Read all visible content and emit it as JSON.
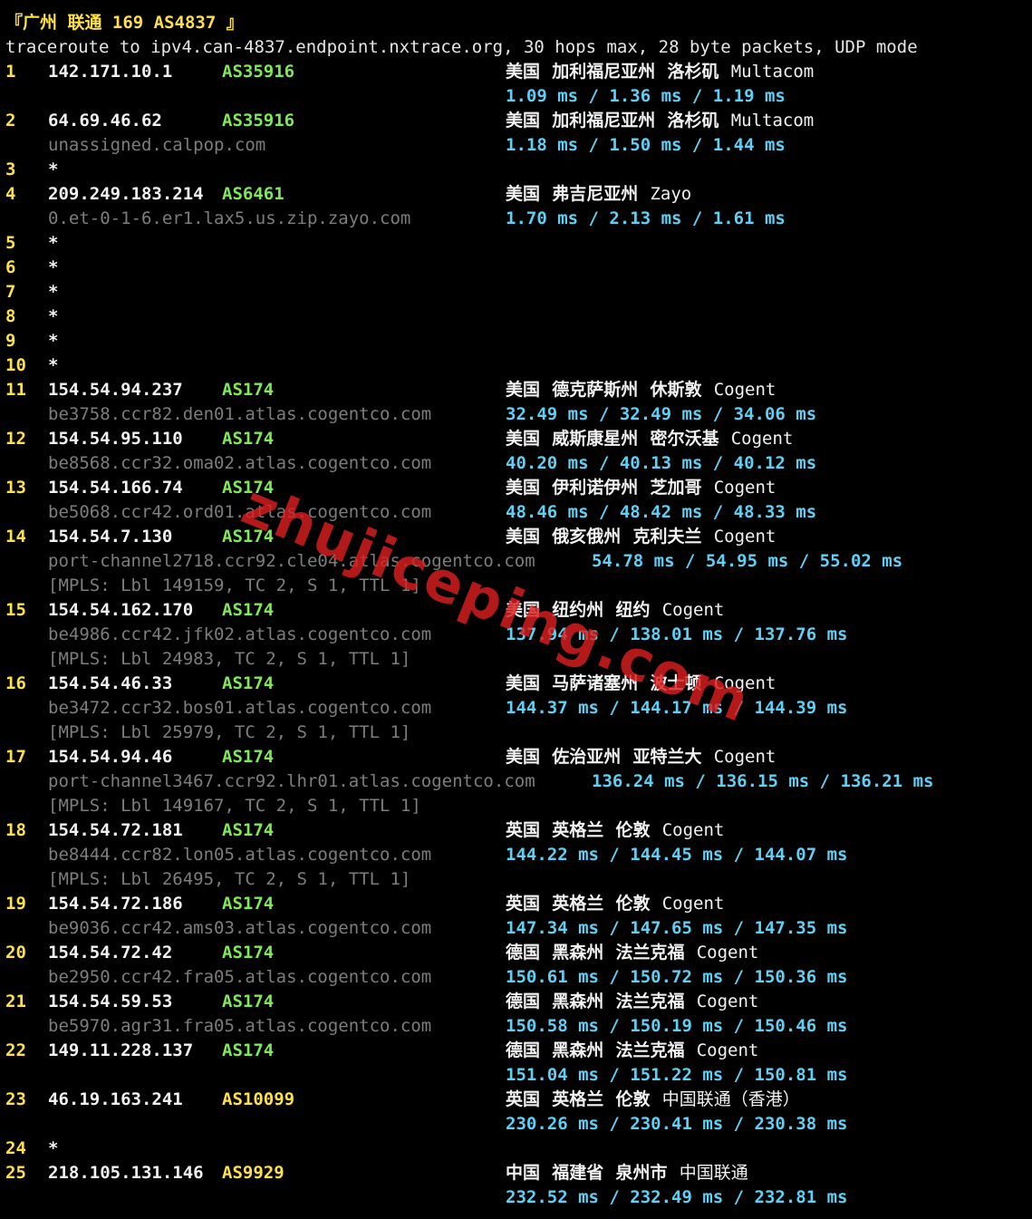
{
  "header": "『广州 联通 169 AS4837 』",
  "command": "traceroute to ipv4.can-4837.endpoint.nxtrace.org, 30 hops max, 28 byte packets, UDP mode",
  "watermark": "zhujiceping.com",
  "colors": {
    "background": "#000000",
    "hop_number": "#ffe04a",
    "asn_green": "#7fe858",
    "asn_yellow": "#ffe04a",
    "hostname": "#7d7d7d",
    "rtt": "#5fd0f5",
    "watermark": "#dc1e1e"
  },
  "hops": [
    {
      "hop": "1",
      "ip": "142.171.10.1",
      "asn": "AS35916",
      "asn_color": "green",
      "geo": "美国  加利福尼亚州  洛杉矶",
      "org": "Multacom",
      "host": "",
      "rtt": "1.09 ms / 1.36 ms / 1.19 ms",
      "mpls": ""
    },
    {
      "hop": "2",
      "ip": "64.69.46.62",
      "asn": "AS35916",
      "asn_color": "green",
      "geo": "美国  加利福尼亚州  洛杉矶",
      "org": "Multacom",
      "host": "unassigned.calpop.com",
      "rtt": "1.18 ms / 1.50 ms / 1.44 ms",
      "mpls": ""
    },
    {
      "hop": "3",
      "star": "*"
    },
    {
      "hop": "4",
      "ip": "209.249.183.214",
      "asn": "AS6461",
      "asn_color": "green",
      "geo": "美国  弗吉尼亚州",
      "org": "Zayo",
      "host": "0.et-0-1-6.er1.lax5.us.zip.zayo.com",
      "rtt": "1.70 ms / 2.13 ms / 1.61 ms",
      "mpls": ""
    },
    {
      "hop": "5",
      "star": "*"
    },
    {
      "hop": "6",
      "star": "*"
    },
    {
      "hop": "7",
      "star": "*"
    },
    {
      "hop": "8",
      "star": "*"
    },
    {
      "hop": "9",
      "star": "*"
    },
    {
      "hop": "10",
      "star": "*"
    },
    {
      "hop": "11",
      "ip": "154.54.94.237",
      "asn": "AS174",
      "asn_color": "green",
      "geo": "美国  德克萨斯州  休斯敦",
      "org": "Cogent",
      "host": "be3758.ccr82.den01.atlas.cogentco.com",
      "rtt": "32.49 ms / 32.49 ms / 34.06 ms",
      "mpls": ""
    },
    {
      "hop": "12",
      "ip": "154.54.95.110",
      "asn": "AS174",
      "asn_color": "green",
      "geo": "美国  威斯康星州  密尔沃基",
      "org": "Cogent",
      "host": "be8568.ccr32.oma02.atlas.cogentco.com",
      "rtt": "40.20 ms / 40.13 ms / 40.12 ms",
      "mpls": ""
    },
    {
      "hop": "13",
      "ip": "154.54.166.74",
      "asn": "AS174",
      "asn_color": "green",
      "geo": "美国  伊利诺伊州  芝加哥",
      "org": "Cogent",
      "host": "be5068.ccr42.ord01.atlas.cogentco.com",
      "rtt": "48.46 ms / 48.42 ms / 48.33 ms",
      "mpls": ""
    },
    {
      "hop": "14",
      "ip": "154.54.7.130",
      "asn": "AS174",
      "asn_color": "green",
      "geo": "美国  俄亥俄州  克利夫兰",
      "org": "Cogent",
      "host": "port-channel2718.ccr92.cle04.atlas.cogentco.com",
      "rtt": "54.78 ms / 54.95 ms / 55.02 ms",
      "mpls": "[MPLS: Lbl 149159, TC 2, S 1, TTL 1]"
    },
    {
      "hop": "15",
      "ip": "154.54.162.170",
      "asn": "AS174",
      "asn_color": "green",
      "geo": "美国  纽约州  纽约",
      "org": "Cogent",
      "host": "be4986.ccr42.jfk02.atlas.cogentco.com",
      "rtt": "137.94 ms / 138.01 ms / 137.76 ms",
      "mpls": "[MPLS: Lbl 24983, TC 2, S 1, TTL 1]"
    },
    {
      "hop": "16",
      "ip": "154.54.46.33",
      "asn": "AS174",
      "asn_color": "green",
      "geo": "美国  马萨诸塞州  波士顿",
      "org": "Cogent",
      "host": "be3472.ccr32.bos01.atlas.cogentco.com",
      "rtt": "144.37 ms / 144.17 ms / 144.39 ms",
      "mpls": "[MPLS: Lbl 25979, TC 2, S 1, TTL 1]"
    },
    {
      "hop": "17",
      "ip": "154.54.94.46",
      "asn": "AS174",
      "asn_color": "green",
      "geo": "美国  佐治亚州  亚特兰大",
      "org": "Cogent",
      "host": "port-channel3467.ccr92.lhr01.atlas.cogentco.com",
      "rtt": "136.24 ms / 136.15 ms / 136.21 ms",
      "mpls": "[MPLS: Lbl 149167, TC 2, S 1, TTL 1]"
    },
    {
      "hop": "18",
      "ip": "154.54.72.181",
      "asn": "AS174",
      "asn_color": "green",
      "geo": "英国  英格兰  伦敦",
      "org": "Cogent",
      "host": "be8444.ccr82.lon05.atlas.cogentco.com",
      "rtt": "144.22 ms / 144.45 ms / 144.07 ms",
      "mpls": "[MPLS: Lbl 26495, TC 2, S 1, TTL 1]"
    },
    {
      "hop": "19",
      "ip": "154.54.72.186",
      "asn": "AS174",
      "asn_color": "green",
      "geo": "英国  英格兰  伦敦",
      "org": "Cogent",
      "host": "be9036.ccr42.ams03.atlas.cogentco.com",
      "rtt": "147.34 ms / 147.65 ms / 147.35 ms",
      "mpls": ""
    },
    {
      "hop": "20",
      "ip": "154.54.72.42",
      "asn": "AS174",
      "asn_color": "green",
      "geo": "德国  黑森州  法兰克福",
      "org": "Cogent",
      "host": "be2950.ccr42.fra05.atlas.cogentco.com",
      "rtt": "150.61 ms / 150.72 ms / 150.36 ms",
      "mpls": ""
    },
    {
      "hop": "21",
      "ip": "154.54.59.53",
      "asn": "AS174",
      "asn_color": "green",
      "geo": "德国  黑森州  法兰克福",
      "org": "Cogent",
      "host": "be5970.agr31.fra05.atlas.cogentco.com",
      "rtt": "150.58 ms / 150.19 ms / 150.46 ms",
      "mpls": ""
    },
    {
      "hop": "22",
      "ip": "149.11.228.137",
      "asn": "AS174",
      "asn_color": "green",
      "geo": "德国  黑森州  法兰克福",
      "org": "Cogent",
      "host": "",
      "rtt": "151.04 ms / 151.22 ms / 150.81 ms",
      "mpls": ""
    },
    {
      "hop": "23",
      "ip": "46.19.163.241",
      "asn": "AS10099",
      "asn_color": "yellow",
      "geo": "英国  英格兰  伦敦",
      "org": "中国联通（香港）",
      "host": "",
      "rtt": "230.26 ms / 230.41 ms / 230.38 ms",
      "mpls": ""
    },
    {
      "hop": "24",
      "star": "*"
    },
    {
      "hop": "25",
      "ip": "218.105.131.146",
      "asn": "AS9929",
      "asn_color": "yellow",
      "geo": "中国  福建省  泉州市",
      "org": "中国联通",
      "host": "",
      "rtt": "232.52 ms / 232.49 ms / 232.81 ms",
      "mpls": ""
    }
  ]
}
